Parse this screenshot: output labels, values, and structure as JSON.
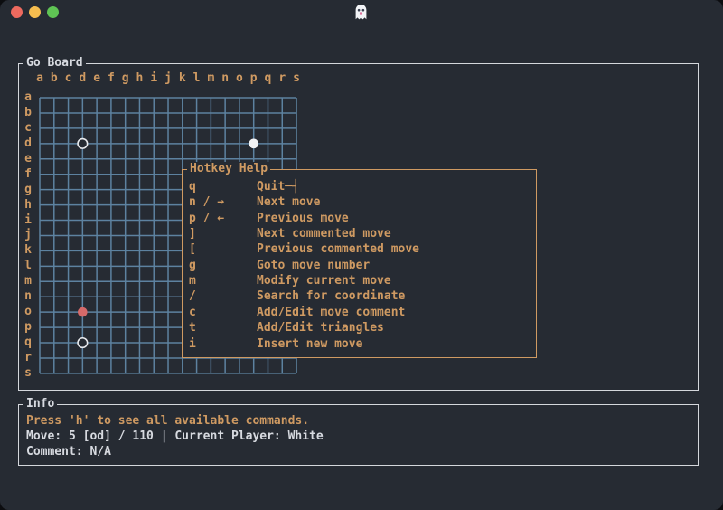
{
  "window": {
    "titlebar": {
      "traffic_lights": [
        "close",
        "minimize",
        "zoom"
      ],
      "ghost_icon": "ghost-emoji"
    },
    "colors": {
      "background": "#262b33",
      "foreground": "#d7dae0",
      "accent_orange": "#cf9a62",
      "grid_blue": "#5d82a0",
      "stone_red": "#d56a6a",
      "stone_white": "#f2f3f5",
      "panel_border": "#d4d7dc",
      "traffic_red": "#ee6a5f",
      "traffic_yellow": "#f5bd4f",
      "traffic_green": "#5fc454"
    }
  },
  "board_panel": {
    "title": "Go Board",
    "column_labels": [
      "a",
      "b",
      "c",
      "d",
      "e",
      "f",
      "g",
      "h",
      "i",
      "j",
      "k",
      "l",
      "m",
      "n",
      "o",
      "p",
      "q",
      "r",
      "s"
    ],
    "row_labels": [
      "a",
      "b",
      "c",
      "d",
      "e",
      "f",
      "g",
      "h",
      "i",
      "j",
      "k",
      "l",
      "m",
      "n",
      "o",
      "p",
      "q",
      "r",
      "s"
    ],
    "stones": [
      {
        "col": "d",
        "row": "d",
        "type": "hollow-circle"
      },
      {
        "col": "p",
        "row": "d",
        "type": "white-filled"
      },
      {
        "col": "d",
        "row": "o",
        "type": "red-filled"
      },
      {
        "col": "d",
        "row": "q",
        "type": "hollow-circle"
      }
    ]
  },
  "hotkey_panel": {
    "title": "Hotkey Help",
    "entries": [
      {
        "key": "q",
        "action": "Quit",
        "trailing_glyph": "─┤"
      },
      {
        "key": "n / →",
        "action": "Next move",
        "trailing_glyph": ""
      },
      {
        "key": "p / ←",
        "action": "Previous move",
        "trailing_glyph": ""
      },
      {
        "key": "]",
        "action": "Next commented move",
        "trailing_glyph": ""
      },
      {
        "key": "[",
        "action": "Previous commented move",
        "trailing_glyph": ""
      },
      {
        "key": "g",
        "action": "Goto move number",
        "trailing_glyph": ""
      },
      {
        "key": "m",
        "action": "Modify current move",
        "trailing_glyph": ""
      },
      {
        "key": "/",
        "action": "Search for coordinate",
        "trailing_glyph": ""
      },
      {
        "key": "c",
        "action": "Add/Edit move comment",
        "trailing_glyph": ""
      },
      {
        "key": "t",
        "action": "Add/Edit triangles",
        "trailing_glyph": ""
      },
      {
        "key": "i",
        "action": "Insert new move",
        "trailing_glyph": ""
      }
    ]
  },
  "info_panel": {
    "title": "Info",
    "hint": "Press 'h' to see all available commands.",
    "move_line": "Move: 5 [od] / 110 | Current Player: White",
    "comment_line": "Comment: N/A"
  }
}
